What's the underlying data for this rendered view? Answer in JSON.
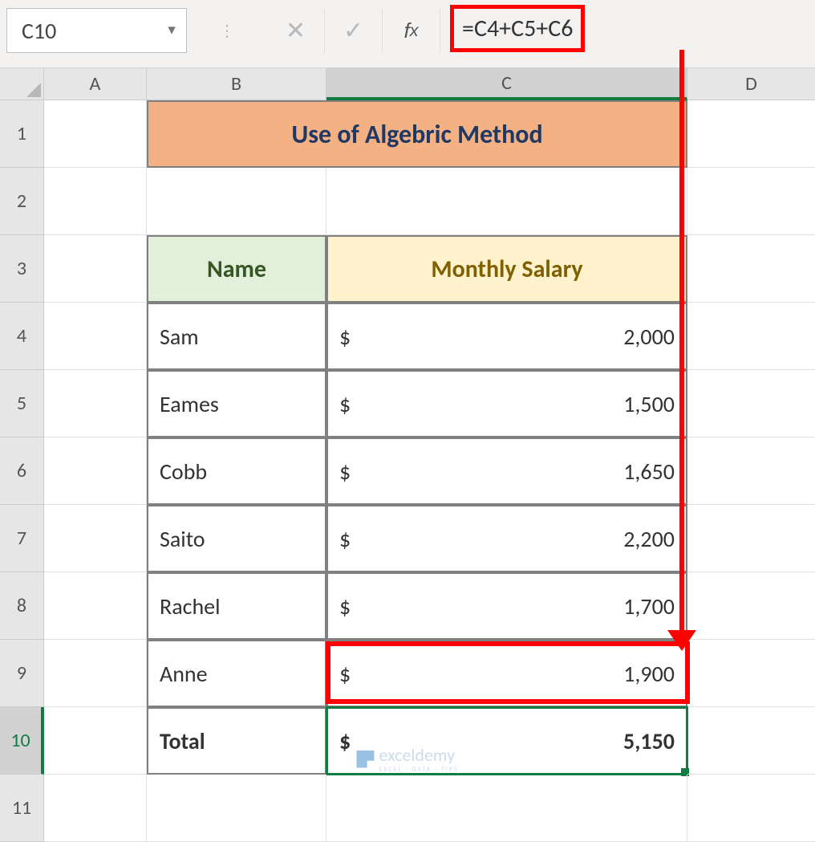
{
  "formula_bar": {
    "name_box": "C10",
    "formula": "=C4+C5+C6"
  },
  "columns": {
    "A": "A",
    "B": "B",
    "C": "C",
    "D": "D"
  },
  "rows_labels": [
    "1",
    "2",
    "3",
    "4",
    "5",
    "6",
    "7",
    "8",
    "9",
    "10",
    "11"
  ],
  "sheet": {
    "title": "Use of Algebric Method",
    "headers": {
      "name": "Name",
      "salary": "Monthly Salary"
    },
    "currency": "$",
    "rows": [
      {
        "name": "Sam",
        "salary": "2,000"
      },
      {
        "name": "Eames",
        "salary": "1,500"
      },
      {
        "name": "Cobb",
        "salary": "1,650"
      },
      {
        "name": "Saito",
        "salary": "2,200"
      },
      {
        "name": "Rachel",
        "salary": "1,700"
      },
      {
        "name": "Anne",
        "salary": "1,900"
      }
    ],
    "total_label": "Total",
    "total_value": "5,150"
  },
  "watermark": {
    "brand": "exceldemy",
    "sub": "EXCEL · DATA · TIPS"
  }
}
